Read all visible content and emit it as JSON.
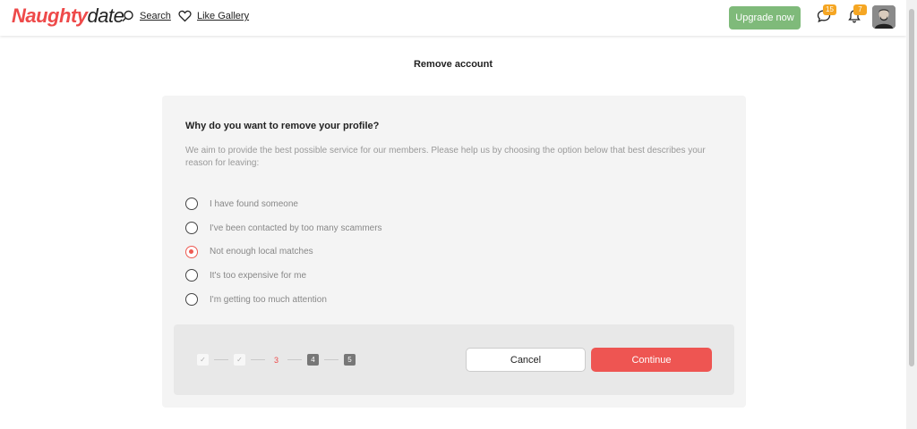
{
  "header": {
    "logo_part1": "Naughty",
    "logo_part2": "date",
    "search_label": "Search",
    "gallery_label": "Like Gallery",
    "upgrade_label": "Upgrade now",
    "messages_count": "15",
    "notifications_count": "7"
  },
  "page": {
    "title": "Remove account"
  },
  "form": {
    "question": "Why do you want to remove your profile?",
    "description": "We aim to provide the best possible service for our members. Please help us by choosing the option below that best describes your reason for leaving:",
    "options": [
      {
        "label": "I have found someone",
        "checked": false
      },
      {
        "label": "I've been contacted by too many scammers",
        "checked": false
      },
      {
        "label": "Not enough local matches",
        "checked": true
      },
      {
        "label": "It's too expensive for me",
        "checked": false
      },
      {
        "label": "I'm getting too much attention",
        "checked": false
      }
    ]
  },
  "steps": [
    {
      "label": "✓",
      "state": "done"
    },
    {
      "label": "✓",
      "state": "done"
    },
    {
      "label": "3",
      "state": "current"
    },
    {
      "label": "4",
      "state": "pending"
    },
    {
      "label": "5",
      "state": "pending"
    }
  ],
  "actions": {
    "cancel_label": "Cancel",
    "continue_label": "Continue"
  },
  "colors": {
    "brand": "#ee4a4a",
    "upgrade": "#7fba7a",
    "badge": "#f5a623"
  }
}
